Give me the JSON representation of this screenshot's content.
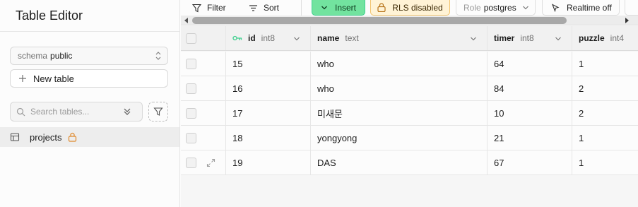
{
  "sidebar": {
    "title": "Table Editor",
    "schema": {
      "label": "schema",
      "value": "public"
    },
    "new_table_label": "New table",
    "search_placeholder": "Search tables...",
    "tables": [
      {
        "name": "projects",
        "rls_disabled": true
      }
    ]
  },
  "toolbar": {
    "filter_label": "Filter",
    "sort_label": "Sort",
    "insert_label": "Insert",
    "rls_label": "RLS disabled",
    "role_label": "Role",
    "role_value": "postgres",
    "realtime_label": "Realtime off"
  },
  "grid": {
    "columns": [
      {
        "name": "id",
        "type": "int8",
        "primary_key": true
      },
      {
        "name": "name",
        "type": "text"
      },
      {
        "name": "timer",
        "type": "int8"
      },
      {
        "name": "puzzle",
        "type": "int4"
      }
    ],
    "rows": [
      {
        "id": "15",
        "name": "who",
        "timer": "64",
        "puzzle": "1"
      },
      {
        "id": "16",
        "name": "who",
        "timer": "84",
        "puzzle": "2"
      },
      {
        "id": "17",
        "name": "미새문",
        "timer": "10",
        "puzzle": "2"
      },
      {
        "id": "18",
        "name": "yongyong",
        "timer": "21",
        "puzzle": "1"
      },
      {
        "id": "19",
        "name": "DAS",
        "timer": "67",
        "puzzle": "1"
      }
    ]
  },
  "colors": {
    "insert_bg": "#72e39f",
    "rls_bg": "#fff3d6",
    "lock": "#e0892b",
    "key": "#3ecf8e"
  }
}
